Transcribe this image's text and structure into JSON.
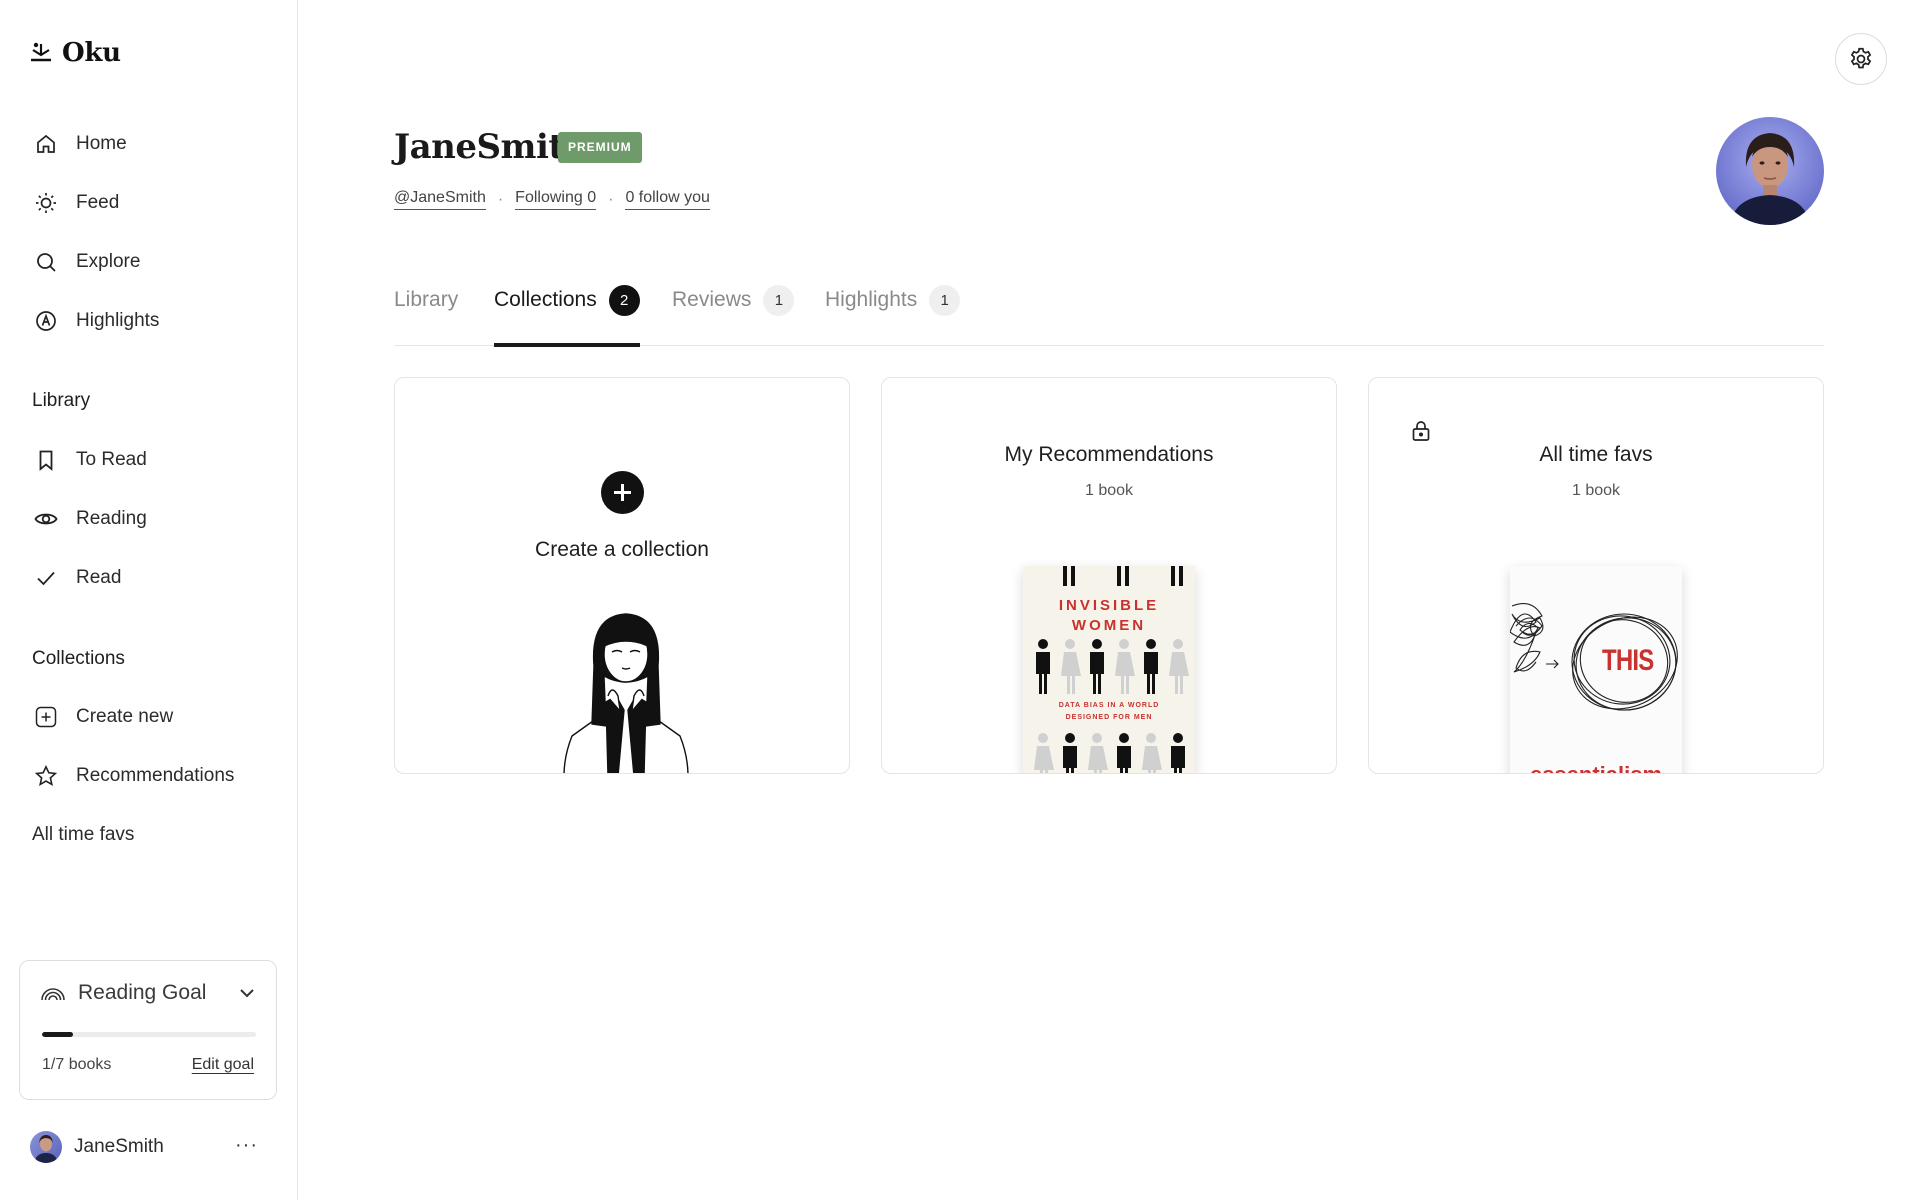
{
  "app": {
    "name": "Oku"
  },
  "sidebar": {
    "nav": [
      {
        "label": "Home",
        "icon": "home-icon"
      },
      {
        "label": "Feed",
        "icon": "sun-icon"
      },
      {
        "label": "Explore",
        "icon": "search-icon"
      },
      {
        "label": "Highlights",
        "icon": "highlight-icon"
      }
    ],
    "library_heading": "Library",
    "library": [
      {
        "label": "To Read",
        "icon": "bookmark-icon"
      },
      {
        "label": "Reading",
        "icon": "eye-icon"
      },
      {
        "label": "Read",
        "icon": "check-icon"
      }
    ],
    "collections_heading": "Collections",
    "collections": [
      {
        "label": "Create new",
        "icon": "plus-square-icon"
      },
      {
        "label": "Recommendations",
        "icon": "star-icon"
      },
      {
        "label": "All time favs",
        "icon": ""
      }
    ],
    "reading_goal": {
      "title": "Reading Goal",
      "progress_fraction": 0.1429,
      "count_text": "1/7 books",
      "edit_label": "Edit goal"
    },
    "user": {
      "name": "JaneSmith",
      "more_label": "···"
    }
  },
  "profile": {
    "display_name": "JaneSmith",
    "badge": "PREMIUM",
    "handle": "@JaneSmith",
    "following": "Following 0",
    "followers": "0 follow you",
    "separator": "·"
  },
  "tabs": [
    {
      "label": "Library",
      "count": "",
      "active": false
    },
    {
      "label": "Collections",
      "count": "2",
      "active": true
    },
    {
      "label": "Reviews",
      "count": "1",
      "active": false
    },
    {
      "label": "Highlights",
      "count": "1",
      "active": false
    }
  ],
  "collections": {
    "create_label": "Create a collection",
    "cards": [
      {
        "title": "My Recommendations",
        "count": "1 book",
        "private": false,
        "cover": {
          "title_lines": "INVISIBLE\nWOMEN",
          "subtitle": "DATA BIAS IN A WORLD\nDESIGNED FOR MEN"
        }
      },
      {
        "title": "All time favs",
        "count": "1 book",
        "private": true,
        "cover": {
          "word": "THIS",
          "title": "essentialism"
        }
      }
    ]
  },
  "colors": {
    "accent_badge": "#6f9a6a",
    "cover_red": "#c8322f",
    "text": "#1a1a1a"
  }
}
